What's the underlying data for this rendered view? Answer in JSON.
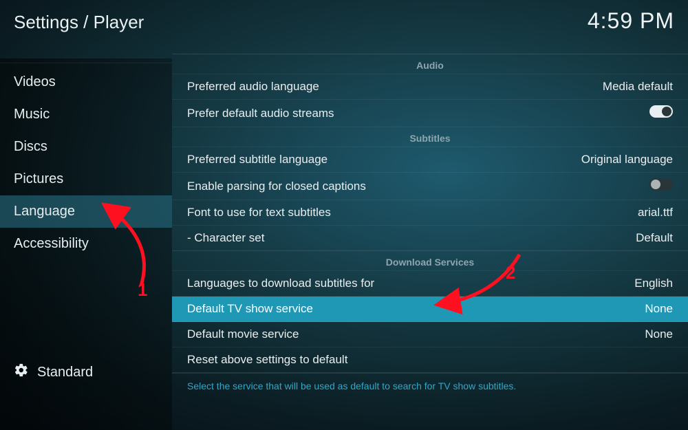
{
  "header": {
    "breadcrumb": "Settings / Player",
    "clock": "4:59 PM"
  },
  "sidebar": {
    "items": [
      {
        "label": "Videos"
      },
      {
        "label": "Music"
      },
      {
        "label": "Discs"
      },
      {
        "label": "Pictures"
      },
      {
        "label": "Language"
      },
      {
        "label": "Accessibility"
      }
    ],
    "selected_index": 4,
    "level_label": "Standard"
  },
  "groups": {
    "audio": {
      "title": "Audio",
      "pref_lang": {
        "label": "Preferred audio language",
        "value": "Media default"
      },
      "prefer_default_streams": {
        "label": "Prefer default audio streams",
        "value": true
      }
    },
    "subtitles": {
      "title": "Subtitles",
      "pref_lang": {
        "label": "Preferred subtitle language",
        "value": "Original language"
      },
      "closed_captions": {
        "label": "Enable parsing for closed captions",
        "value": false
      },
      "font": {
        "label": "Font to use for text subtitles",
        "value": "arial.ttf"
      },
      "charset": {
        "label": "- Character set",
        "value": "Default"
      }
    },
    "downloads": {
      "title": "Download Services",
      "languages": {
        "label": "Languages to download subtitles for",
        "value": "English"
      },
      "tv_service": {
        "label": "Default TV show service",
        "value": "None"
      },
      "movie_service": {
        "label": "Default movie service",
        "value": "None"
      },
      "reset": {
        "label": "Reset above settings to default"
      }
    }
  },
  "help_text": "Select the service that will be used as default to search for TV show subtitles.",
  "annotations": {
    "step1": "1",
    "step2": "2"
  },
  "colors": {
    "accent": "#1f98b5",
    "annotation": "#ff1020"
  }
}
